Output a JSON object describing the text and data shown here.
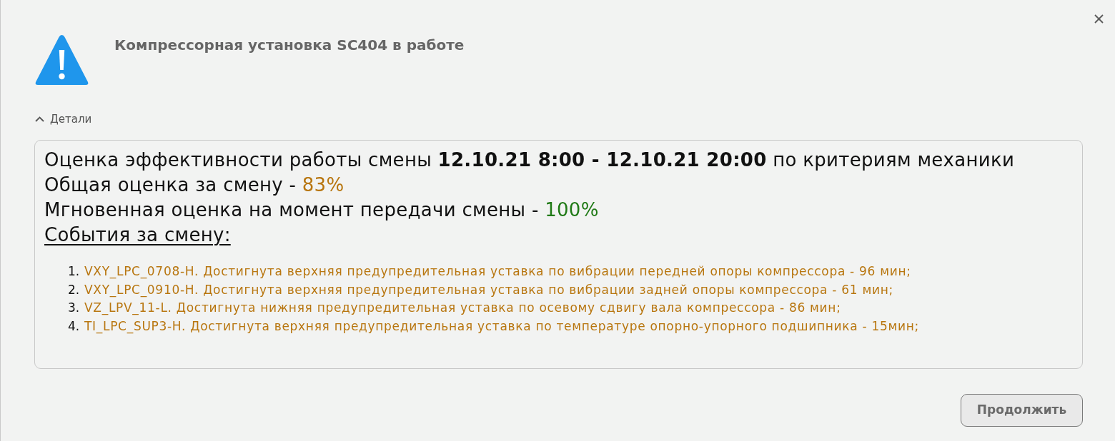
{
  "dialog": {
    "title": "Компрессорная установка SC404 в работе"
  },
  "details": {
    "label": "Детали",
    "expanded": true,
    "lines": [
      {
        "kind": "text",
        "text": "Оценка эффективности работы смены **12.10.21 8:00 - 12.10.21 20:00** по критериям механики"
      },
      {
        "kind": "score",
        "label": "Общая оценка за смену -",
        "value": "83%",
        "color": "#b8760f"
      },
      {
        "kind": "score",
        "label": "Мгновенная оценка на момент передачи смены -",
        "value": "100%",
        "color": "#217a17"
      },
      {
        "kind": "heading",
        "text": "События за смену:"
      }
    ],
    "events": [
      {
        "number": "1.",
        "text": "VXY_LPC_0708-H. Достигнута верхняя предупредительная уставка по вибрации передней опоры компрессора - 96 мин;"
      },
      {
        "number": "2.",
        "text": "VXY_LPC_0910-H. Достигнута верхняя предупредительная уставка по вибрации задней опоры компрессора - 61 мин;"
      },
      {
        "number": "3.",
        "text": "VZ_LPV_11-L. Достигнута нижняя предупредительная уставка по осевому сдвигу вала компрессора - 86 мин;"
      },
      {
        "number": "4.",
        "text": "TI_LPC_SUP3-H. Достигнута верхняя предупредительная уставка по температуре опорно-упорного подшипника - 15мин;"
      }
    ]
  },
  "buttons": [
    {
      "label": "Продолжить"
    }
  ]
}
